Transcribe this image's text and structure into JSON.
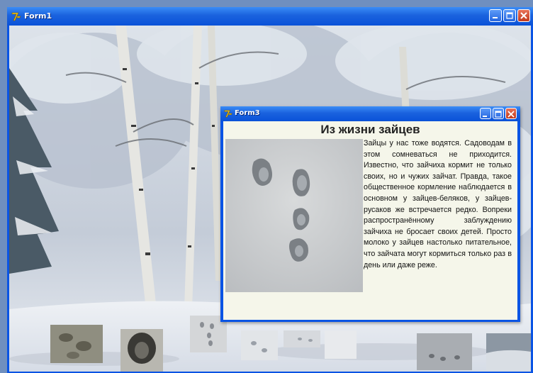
{
  "main_window": {
    "title": "Form1",
    "title_icon": "delphi-app-icon",
    "buttons": [
      "minimize-icon",
      "maximize-icon",
      "close-icon"
    ]
  },
  "dialog_window": {
    "title": "Form3",
    "title_icon": "delphi-app-icon",
    "buttons": [
      "minimize-icon",
      "maximize-icon",
      "close-icon"
    ],
    "article_title": "Из жизни зайцев",
    "article_text": "Зайцы у нас тоже водятся. Садоводам в этом сомневаться не приходится. Известно, что зайчиха кормит не только своих, но и чужих зайчат. Правда, такое общественное кормление наблюдается в основном у зайцев-беляков, у зайцев-русаков же встречается редко. Вопреки распространённому заблуждению зайчиха не бросает своих детей. Просто молоко у зайцев настолько питательное, что зайчата могут кормиться только раз в день или даже реже."
  },
  "thumbnails_count": 8,
  "colors": {
    "xp_title_blue": "#0a54e4",
    "xp_close_red": "#c23a1c",
    "dialog_bg": "#f5f6ea"
  }
}
